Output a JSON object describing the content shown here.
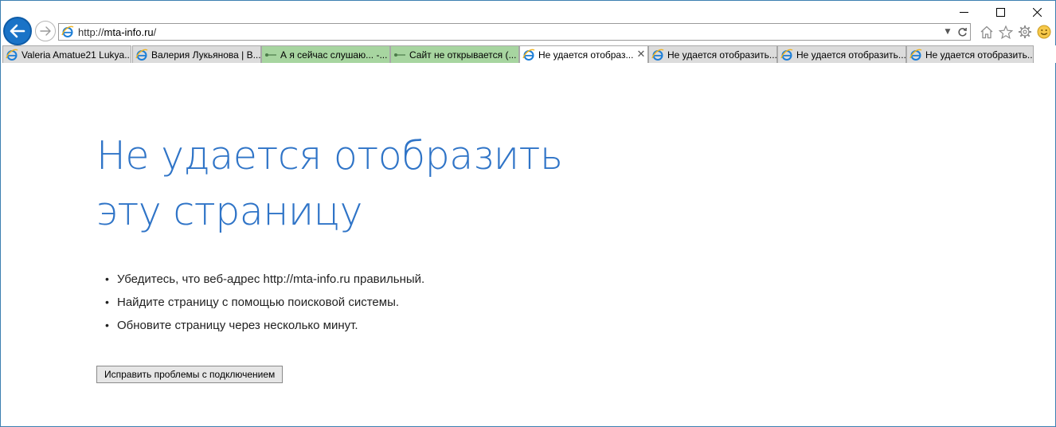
{
  "browser": {
    "address": {
      "prefix": "http://",
      "host": "mta-info.ru",
      "suffix": "/"
    },
    "accent_color": "#1a73c7",
    "tabs": [
      {
        "label": "Valeria Amatue21 Lukya...",
        "icon": "ie-icon",
        "style": "default"
      },
      {
        "label": "Валерия Лукьянова | В...",
        "icon": "ie-icon",
        "style": "default"
      },
      {
        "label": "А я сейчас слушаю... -...",
        "icon": "link-icon",
        "style": "green"
      },
      {
        "label": "Сайт не открывается (...",
        "icon": "link-icon",
        "style": "green"
      },
      {
        "label": "Не удается отобраз...",
        "icon": "ie-icon",
        "style": "active",
        "close": "✕"
      },
      {
        "label": "Не удается отобразить...",
        "icon": "ie-icon",
        "style": "default"
      },
      {
        "label": "Не удается отобразить...",
        "icon": "ie-icon",
        "style": "default"
      },
      {
        "label": "Не удается отобразить...",
        "icon": "ie-icon",
        "style": "default"
      }
    ]
  },
  "page": {
    "heading": "Не удается отобразить эту страницу",
    "heading_color": "#2f74c7",
    "bullets": [
      "Убедитесь, что веб-адрес http://mta-info.ru правильный.",
      "Найдите страницу с помощью поисковой системы.",
      "Обновите страницу через несколько минут."
    ],
    "fix_button": "Исправить проблемы с подключением"
  }
}
